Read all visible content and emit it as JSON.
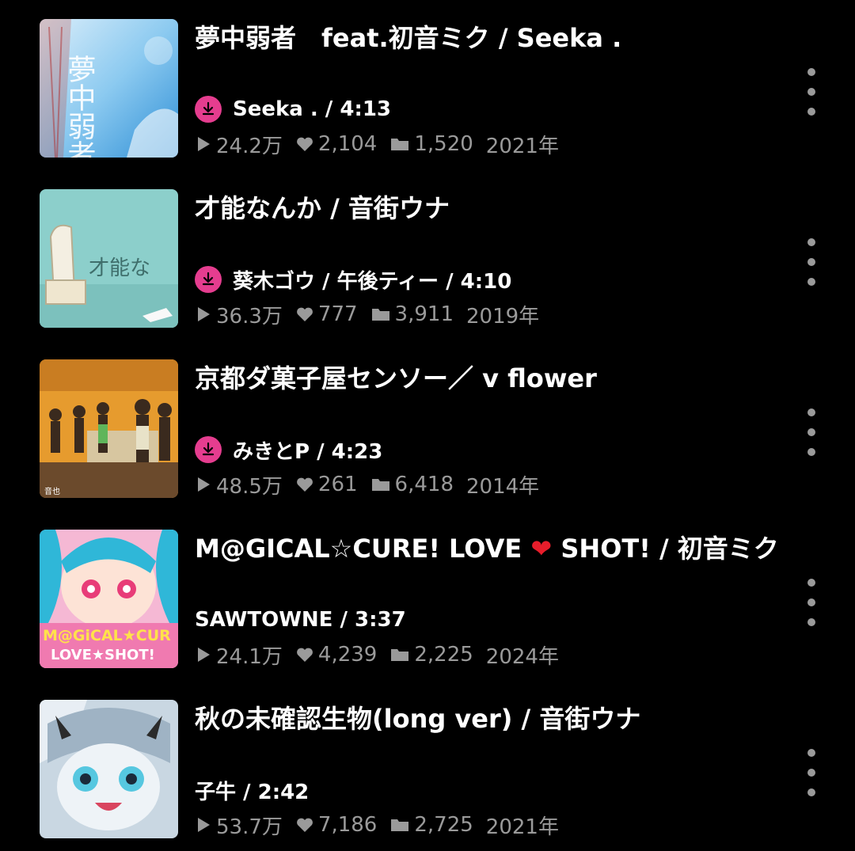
{
  "items": [
    {
      "title": "夢中弱者　feat.初音ミク / Seeka .",
      "artist": "Seeka . / 4:13",
      "downloaded": true,
      "plays": "24.2万",
      "likes": "2,104",
      "saves": "1,520",
      "year": "2021年"
    },
    {
      "title": "才能なんか / 音街ウナ",
      "artist": "葵木ゴウ / 午後ティー / 4:10",
      "downloaded": true,
      "plays": "36.3万",
      "likes": "777",
      "saves": "3,911",
      "year": "2019年"
    },
    {
      "title": "京都ダ菓子屋センソー／ v flower",
      "artist": "みきとP / 4:23",
      "downloaded": true,
      "plays": "48.5万",
      "likes": "261",
      "saves": "6,418",
      "year": "2014年"
    },
    {
      "title_pre": "M@GICAL☆CURE! LOVE ",
      "title_heart": "❤",
      "title_post": " SHOT! / 初音ミク",
      "artist": "SAWTOWNE / 3:37",
      "downloaded": false,
      "plays": "24.1万",
      "likes": "4,239",
      "saves": "2,225",
      "year": "2024年"
    },
    {
      "title": "秋の未確認生物(long ver) / 音街ウナ",
      "artist": "子牛 / 2:42",
      "downloaded": false,
      "plays": "53.7万",
      "likes": "7,186",
      "saves": "2,725",
      "year": "2021年"
    }
  ],
  "thumbnail_art": {
    "t1": {
      "text": "夢中弱者"
    },
    "t2": {
      "text": "才能な"
    },
    "t3": {
      "text": "音也"
    },
    "t4": {
      "line1": "M@GiCAL★CUR",
      "line2": "LOVE★SHOT!"
    }
  },
  "colors": {
    "background": "#000000",
    "download_badge": "#e53d8f",
    "secondary_text": "#9a9a9a"
  },
  "icons": {
    "download": "download-icon",
    "plays": "play-icon",
    "likes": "heart-icon",
    "saves": "folder-icon",
    "more": "more-vertical-icon"
  }
}
